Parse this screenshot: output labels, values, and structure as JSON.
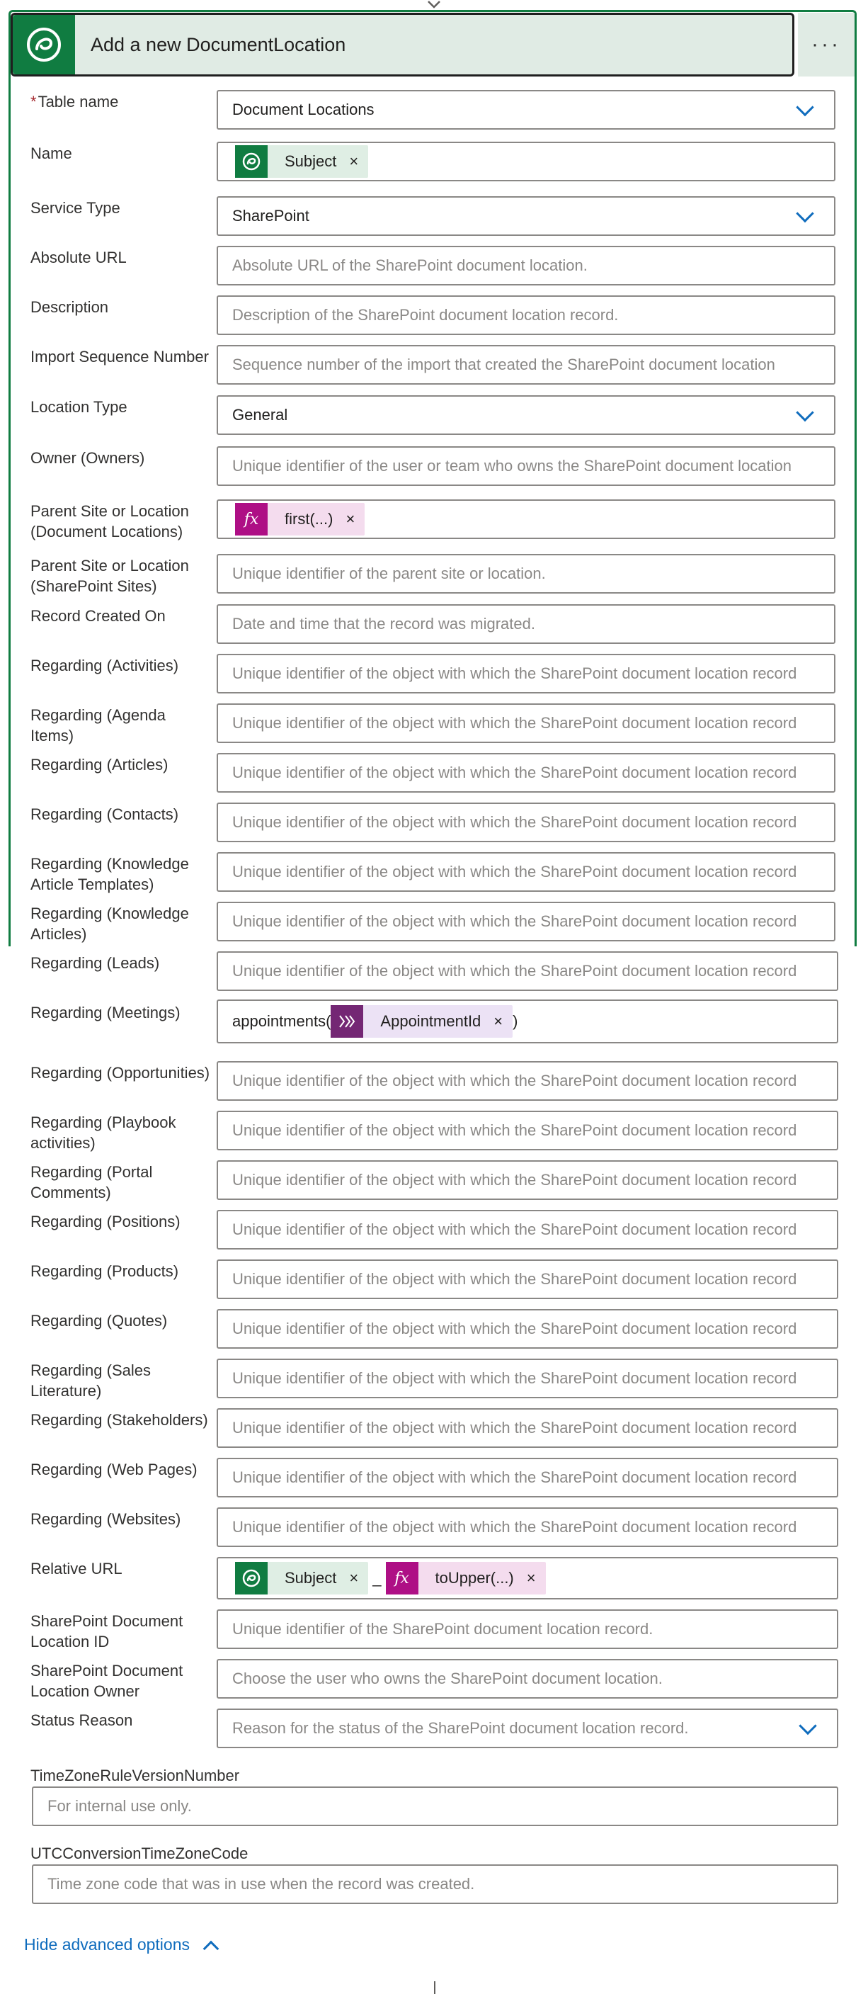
{
  "header": {
    "title": "Add a new DocumentLocation",
    "more": "···"
  },
  "fields": [
    {
      "label": "Table name",
      "required": true,
      "kind": "dropdown",
      "value": "Document Locations"
    },
    {
      "label": "Name",
      "kind": "tokens",
      "tokens": [
        {
          "icon": "dataverse",
          "text": "Subject"
        }
      ]
    },
    {
      "label": "Service Type",
      "kind": "dropdown",
      "value": "SharePoint"
    },
    {
      "label": "Absolute URL",
      "kind": "text",
      "placeholder": "Absolute URL of the SharePoint document location."
    },
    {
      "label": "Description",
      "kind": "text",
      "placeholder": "Description of the SharePoint document location record."
    },
    {
      "label": "Import Sequence Number",
      "kind": "text",
      "placeholder": "Sequence number of the import that created the SharePoint document location"
    },
    {
      "label": "Location Type",
      "kind": "dropdown",
      "value": "General"
    },
    {
      "label": "Owner (Owners)",
      "kind": "text",
      "placeholder": "Unique identifier of the user or team who owns the SharePoint document location"
    },
    {
      "label": "Parent Site or Location (Document Locations)",
      "kind": "tokens",
      "tokens": [
        {
          "icon": "fx",
          "text": "first(...)"
        }
      ]
    },
    {
      "label": "Parent Site or Location (SharePoint Sites)",
      "kind": "text",
      "placeholder": "Unique identifier of the parent site or location."
    },
    {
      "label": "Record Created On",
      "kind": "text",
      "placeholder": "Date and time that the record was migrated."
    },
    {
      "label": "Regarding (Activities)",
      "kind": "text",
      "placeholder": "Unique identifier of the object with which the SharePoint document location record"
    },
    {
      "label": "Regarding (Agenda Items)",
      "kind": "text",
      "placeholder": "Unique identifier of the object with which the SharePoint document location record"
    },
    {
      "label": "Regarding (Articles)",
      "kind": "text",
      "placeholder": "Unique identifier of the object with which the SharePoint document location record"
    },
    {
      "label": "Regarding (Contacts)",
      "kind": "text",
      "placeholder": "Unique identifier of the object with which the SharePoint document location record"
    },
    {
      "label": "Regarding (Knowledge Article Templates)",
      "kind": "text",
      "placeholder": "Unique identifier of the object with which the SharePoint document location record"
    },
    {
      "label": "Regarding (Knowledge Articles)",
      "kind": "text",
      "placeholder": "Unique identifier of the object with which the SharePoint document location record"
    },
    {
      "label": "Regarding (Leads)",
      "kind": "text",
      "placeholder": "Unique identifier of the object with which the SharePoint document location record"
    },
    {
      "label": "Regarding (Meetings)",
      "kind": "mixed",
      "prefix": "appointments(",
      "tokens": [
        {
          "icon": "meeting",
          "text": "AppointmentId"
        }
      ],
      "suffix": ")"
    },
    {
      "label": "Regarding (Opportunities)",
      "kind": "text",
      "placeholder": "Unique identifier of the object with which the SharePoint document location record"
    },
    {
      "label": "Regarding (Playbook activities)",
      "kind": "text",
      "placeholder": "Unique identifier of the object with which the SharePoint document location record"
    },
    {
      "label": "Regarding (Portal Comments)",
      "kind": "text",
      "placeholder": "Unique identifier of the object with which the SharePoint document location record"
    },
    {
      "label": "Regarding (Positions)",
      "kind": "text",
      "placeholder": "Unique identifier of the object with which the SharePoint document location record"
    },
    {
      "label": "Regarding (Products)",
      "kind": "text",
      "placeholder": "Unique identifier of the object with which the SharePoint document location record"
    },
    {
      "label": "Regarding (Quotes)",
      "kind": "text",
      "placeholder": "Unique identifier of the object with which the SharePoint document location record"
    },
    {
      "label": "Regarding (Sales Literature)",
      "kind": "text",
      "placeholder": "Unique identifier of the object with which the SharePoint document location record"
    },
    {
      "label": "Regarding (Stakeholders)",
      "kind": "text",
      "placeholder": "Unique identifier of the object with which the SharePoint document location record"
    },
    {
      "label": "Regarding (Web Pages)",
      "kind": "text",
      "placeholder": "Unique identifier of the object with which the SharePoint document location record"
    },
    {
      "label": "Regarding (Websites)",
      "kind": "text",
      "placeholder": "Unique identifier of the object with which the SharePoint document location record"
    },
    {
      "label": "Relative URL",
      "kind": "tokens",
      "tokens": [
        {
          "icon": "dataverse",
          "text": "Subject"
        },
        {
          "sep": "_"
        },
        {
          "icon": "fx",
          "text": "toUpper(...)"
        }
      ]
    },
    {
      "label": "SharePoint Document Location ID",
      "kind": "text",
      "placeholder": "Unique identifier of the SharePoint document location record."
    },
    {
      "label": "SharePoint Document Location Owner",
      "kind": "text",
      "placeholder": "Choose the user who owns the SharePoint document location."
    },
    {
      "label": "Status Reason",
      "kind": "dropdown",
      "placeholder": "Reason for the status of the SharePoint document location record."
    }
  ],
  "full_fields": [
    {
      "label": "TimeZoneRuleVersionNumber",
      "placeholder": "For internal use only."
    },
    {
      "label": "UTCConversionTimeZoneCode",
      "placeholder": "Time zone code that was in use when the record was created."
    }
  ],
  "footer": {
    "hide_advanced": "Hide advanced options"
  },
  "colors": {
    "accent": "#107c41",
    "link": "#0f6cbd",
    "fx": "#ae0f85"
  }
}
